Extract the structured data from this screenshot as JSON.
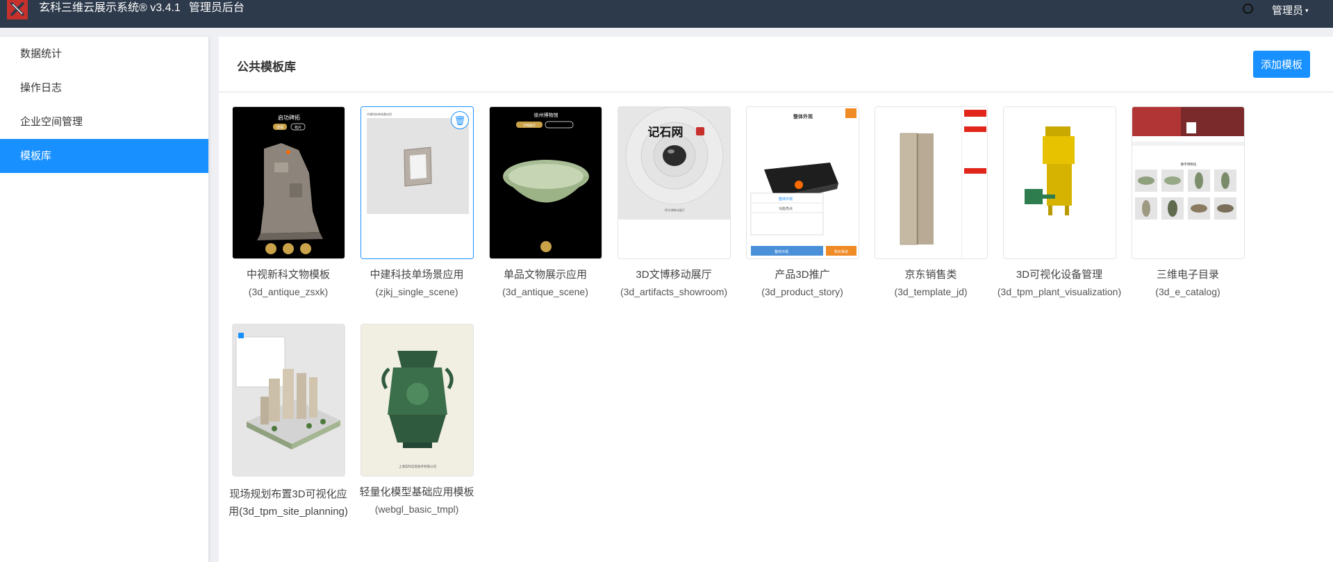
{
  "header": {
    "app_title": "玄科三维云展示系统® v3.4.1",
    "admin_label": "管理员后台",
    "user_menu": "管理员",
    "caret": "▾"
  },
  "sidebar": {
    "items": [
      {
        "label": "数据统计",
        "active": false
      },
      {
        "label": "操作日志",
        "active": false
      },
      {
        "label": "企业空间管理",
        "active": false
      },
      {
        "label": "模板库",
        "active": true
      }
    ]
  },
  "main": {
    "title": "公共模板库",
    "add_button": "添加模板"
  },
  "templates": [
    {
      "name": "中视新科文物模板",
      "code": "(3d_antique_zsxk)",
      "thumb_text": [
        "启功碑拓",
        "详情",
        "拓片"
      ]
    },
    {
      "name": "中建科技单场景应用",
      "code": "(zjkj_single_scene)",
      "thumb_text": [
        "中建科技单场景应用"
      ]
    },
    {
      "name": "单品文物展示应用",
      "code": "(3d_antique_scene)",
      "thumb_text": [
        "徐州博物馆",
        "文物展示"
      ]
    },
    {
      "name": "3D文博移动展厅",
      "code": "(3d_artifacts_showroom)",
      "thumb_text": [
        "记石网",
        "3D文博移动展厅"
      ]
    },
    {
      "name": "产品3D推广",
      "code": "(3d_product_story)",
      "thumb_text": [
        "整体外观",
        "整体外观",
        "功能亮点",
        "整体外观",
        "购买渠道"
      ]
    },
    {
      "name": "京东销售类",
      "code": "(3d_template_jd)",
      "thumb_text": []
    },
    {
      "name": "3D可视化设备管理",
      "code": "(3d_tpm_plant_visualization)",
      "thumb_text": []
    },
    {
      "name": "三维电子目录",
      "code": "(3d_e_catalog)",
      "thumb_text": [
        "数字博物馆"
      ]
    },
    {
      "name": "现场规划布置3D可视化应用(3d_tpm_site_planning)",
      "code": "",
      "thumb_text": []
    },
    {
      "name": "轻量化模型基础应用模板",
      "code": "(webgl_basic_tmpl)",
      "thumb_text": [
        "上海玄科信息技术有限公司"
      ]
    }
  ],
  "icons": {
    "trash": "trash-icon"
  },
  "colors": {
    "topbar": "#2d3a4b",
    "accent": "#1890ff",
    "logo": "#c8302c"
  }
}
